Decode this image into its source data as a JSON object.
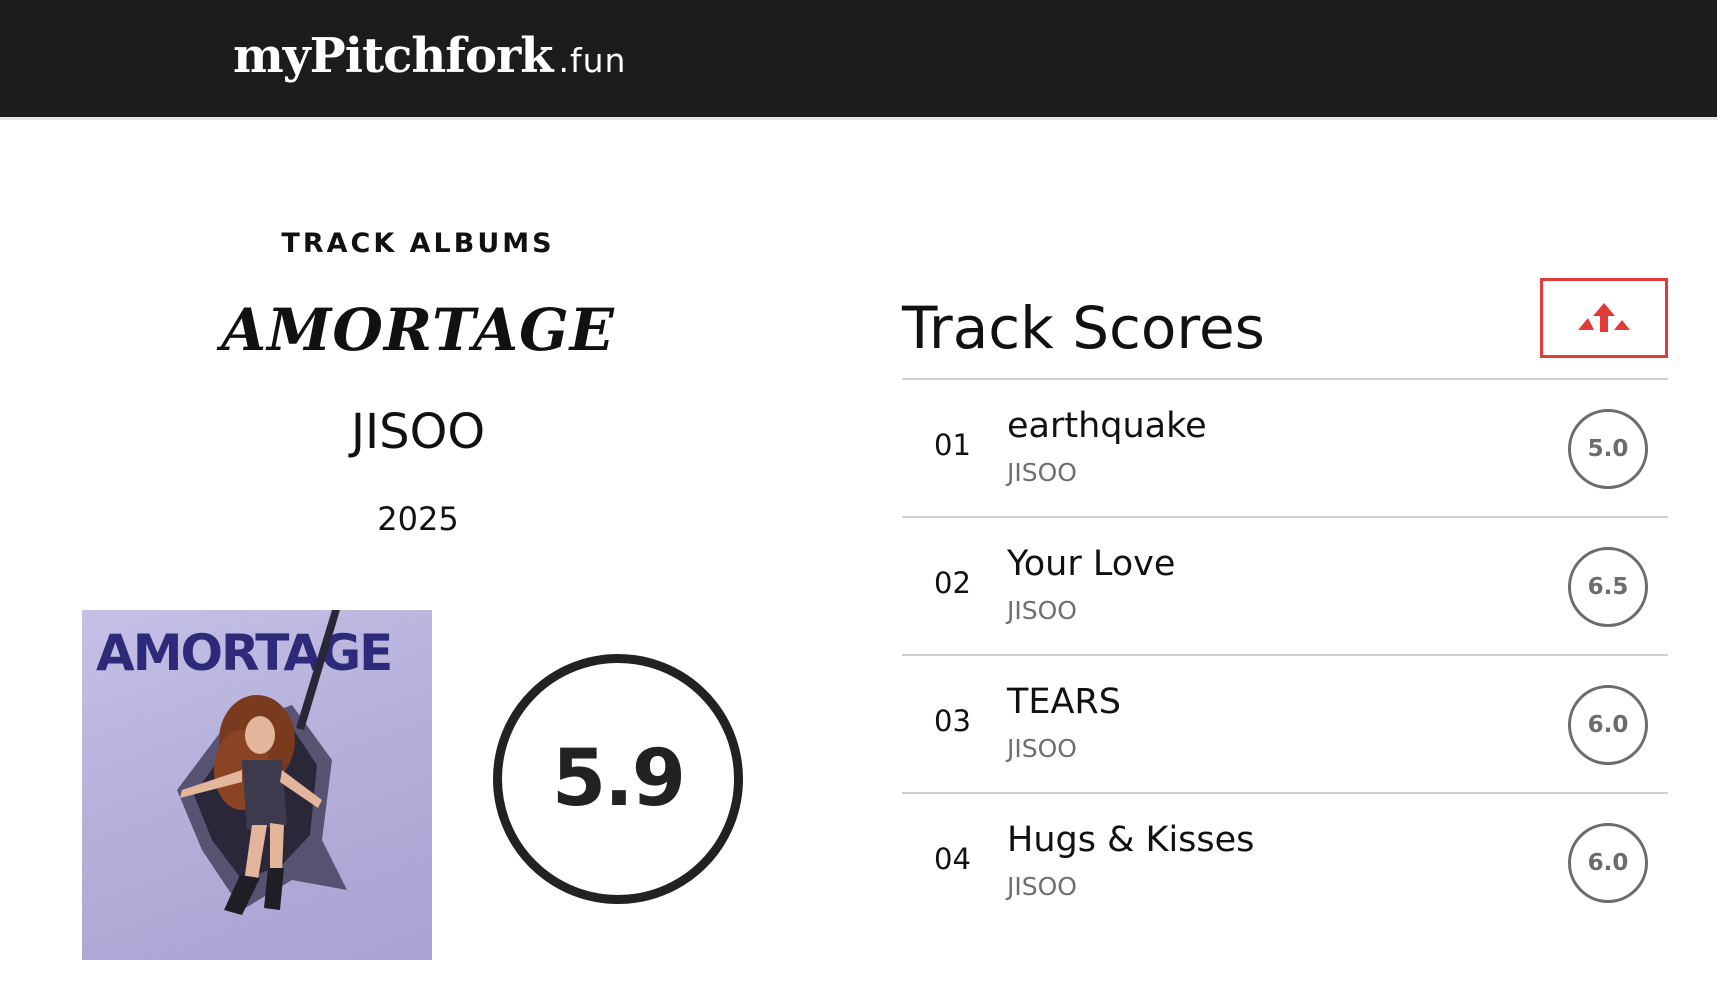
{
  "header": {
    "logo_main": "myPitchfork",
    "logo_suffix": ".fun"
  },
  "album": {
    "kicker": "TRACK ALBUMS",
    "title": "AMORTAGE",
    "artist": "JISOO",
    "year": "2025",
    "cover_text": "AMORTAGE",
    "score": "5.9"
  },
  "tracks_panel": {
    "title": "Track Scores",
    "sort_icon": "sort-up-icon",
    "accent_color": "#e23a36",
    "tracks": [
      {
        "number": "01",
        "name": "earthquake",
        "artist": "JISOO",
        "score": "5.0"
      },
      {
        "number": "02",
        "name": "Your Love",
        "artist": "JISOO",
        "score": "6.5"
      },
      {
        "number": "03",
        "name": "TEARS",
        "artist": "JISOO",
        "score": "6.0"
      },
      {
        "number": "04",
        "name": "Hugs & Kisses",
        "artist": "JISOO",
        "score": "6.0"
      }
    ]
  }
}
